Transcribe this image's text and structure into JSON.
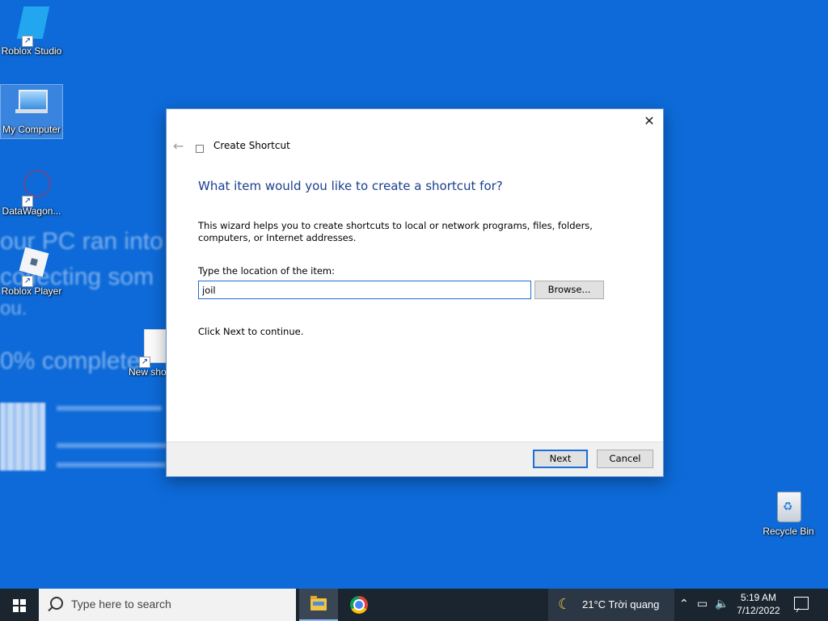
{
  "desktop": {
    "icons": [
      {
        "label": "Roblox Studio"
      },
      {
        "label": "My Computer"
      },
      {
        "label": "DataWagon..."
      },
      {
        "label": "Roblox Player"
      },
      {
        "label": "New sho"
      },
      {
        "label": "Recycle Bin"
      }
    ],
    "wallpaper_text": [
      "our PC ran into a",
      "collecting som",
      "ou.",
      "0% complete"
    ]
  },
  "dialog": {
    "title": "Create Shortcut",
    "heading": "What item would you like to create a shortcut for?",
    "description": "This wizard helps you to create shortcuts to local or network programs, files, folders, computers, or Internet addresses.",
    "location_label": "Type the location of the item:",
    "location_value": "joil",
    "browse_label": "Browse...",
    "continue_text": "Click Next to continue.",
    "next_label": "Next",
    "cancel_label": "Cancel",
    "close_glyph": "✕",
    "back_glyph": "←"
  },
  "taskbar": {
    "search_placeholder": "Type here to search",
    "weather": "21°C  Trời quang",
    "time": "5:19 AM",
    "date": "7/12/2022",
    "pinned": [
      {
        "icon": "file-explorer-icon"
      },
      {
        "icon": "chrome-icon"
      }
    ]
  },
  "colors": {
    "desktop_bg": "#0d6ad8",
    "taskbar_bg": "#1b2530",
    "accent": "#1b6fd6",
    "heading": "#1a3e8f"
  }
}
